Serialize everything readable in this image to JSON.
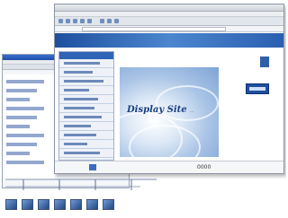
{
  "front_window": {
    "hero_title": "Display Site",
    "hero_subtitle": "...",
    "status_text": "0000"
  },
  "colors": {
    "brand_blue": "#1f4f9f",
    "light_blue": "#a9c4e6",
    "background": "#ffffff"
  },
  "bottom_icons": [
    "app-icon",
    "app-icon",
    "app-icon",
    "app-icon",
    "app-icon",
    "app-icon",
    "app-icon"
  ]
}
